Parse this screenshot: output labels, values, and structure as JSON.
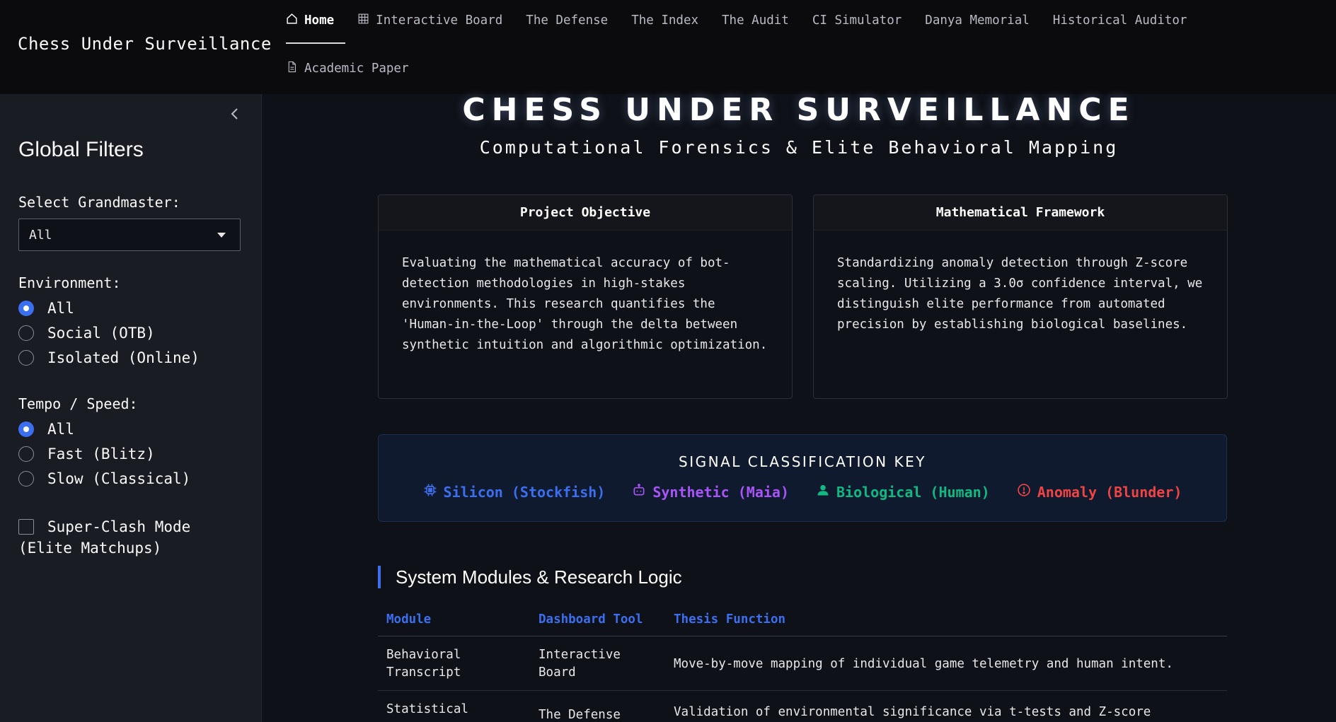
{
  "app": {
    "title": "Chess Under Surveillance"
  },
  "nav": {
    "items": [
      {
        "label": "Home",
        "icon": "home-icon",
        "active": true
      },
      {
        "label": "Interactive Board",
        "icon": "grid-icon"
      },
      {
        "label": "The Defense"
      },
      {
        "label": "The Index"
      },
      {
        "label": "The Audit"
      },
      {
        "label": "CI Simulator"
      },
      {
        "label": "Danya Memorial"
      },
      {
        "label": "Historical Auditor"
      },
      {
        "label": "Academic Paper",
        "icon": "document-icon"
      }
    ]
  },
  "sidebar": {
    "title": "Global Filters",
    "grandmaster_label": "Select Grandmaster:",
    "grandmaster_value": "All",
    "environment_label": "Environment:",
    "environment_options": [
      "All",
      "Social (OTB)",
      "Isolated (Online)"
    ],
    "environment_selected": "All",
    "tempo_label": "Tempo / Speed:",
    "tempo_options": [
      "All",
      "Fast (Blitz)",
      "Slow (Classical)"
    ],
    "tempo_selected": "All",
    "superclash_label": "Super-Clash Mode (Elite Matchups)",
    "superclash_checked": false
  },
  "main": {
    "title": "CHESS UNDER SURVEILLANCE",
    "subtitle": "Computational Forensics & Elite Behavioral Mapping",
    "cards": [
      {
        "title": "Project Objective",
        "body": "Evaluating the mathematical accuracy of bot-detection methodologies in high-stakes environments. This research quantifies the 'Human-in-the-Loop' through the delta between synthetic intuition and algorithmic optimization."
      },
      {
        "title": "Mathematical Framework",
        "body": "Standardizing anomaly detection through Z-score scaling. Utilizing a 3.0σ confidence interval, we distinguish elite performance from automated precision by establishing biological baselines."
      }
    ],
    "key": {
      "title": "SIGNAL CLASSIFICATION KEY",
      "items": [
        {
          "label": "Silicon (Stockfish)",
          "icon": "cpu-icon",
          "color": "#3b6ff0"
        },
        {
          "label": "Synthetic (Maia)",
          "icon": "robot-icon",
          "color": "#a855f7"
        },
        {
          "label": "Biological (Human)",
          "icon": "user-icon",
          "color": "#10b981"
        },
        {
          "label": "Anomaly (Blunder)",
          "icon": "alert-circle-icon",
          "color": "#ef4444"
        }
      ]
    },
    "section_title": "System Modules & Research Logic",
    "table": {
      "headers": [
        "Module",
        "Dashboard Tool",
        "Thesis Function"
      ],
      "rows": [
        [
          "Behavioral Transcript",
          "Interactive Board",
          "Move-by-move mapping of individual game telemetry and human intent."
        ],
        [
          "Statistical",
          "The Defense",
          "Validation of environmental significance via t-tests and Z-score"
        ]
      ]
    }
  },
  "colors": {
    "accent": "#3b6ff0",
    "background": "#0e1117",
    "sidebar": "#1a1c23"
  }
}
